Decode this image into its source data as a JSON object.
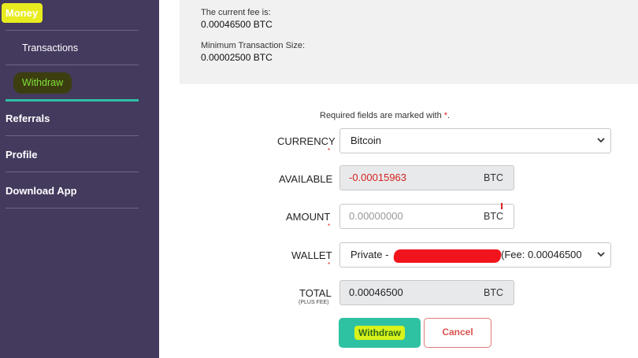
{
  "sidebar": {
    "money": "Money",
    "transactions": "Transactions",
    "withdraw": "Withdraw",
    "referrals": "Referrals",
    "profile": "Profile",
    "download_app": "Download App"
  },
  "info": {
    "fee_label": "The current fee is:",
    "fee_value": "0.00046500 BTC",
    "min_label": "Minimum Transaction Size:",
    "min_value": "0.00002500 BTC"
  },
  "form": {
    "required_note": "Required fields are marked with",
    "required_star": "*",
    "required_period": ".",
    "currency_label": "CURRENCY",
    "currency_value": "Bitcoin",
    "available_label": "AVAILABLE",
    "available_value": "-0.00015963",
    "available_unit": "BTC",
    "amount_label": "AMOUNT",
    "amount_placeholder": "0.00000000",
    "amount_unit": "BTC",
    "wallet_label": "WALLET",
    "wallet_value_prefix": "Private -",
    "wallet_value_suffix": "(Fee: 0.00046500",
    "total_label": "TOTAL",
    "total_sublabel": "(PLUS FEE)",
    "total_value": "0.00046500",
    "total_unit": "BTC",
    "star": "*"
  },
  "buttons": {
    "withdraw": "Withdraw",
    "cancel": "Cancel"
  },
  "colors": {
    "sidebar_bg": "#443a5e",
    "accent": "#2fc0a4",
    "negative": "#d4231f",
    "cancel": "#d9534f"
  }
}
